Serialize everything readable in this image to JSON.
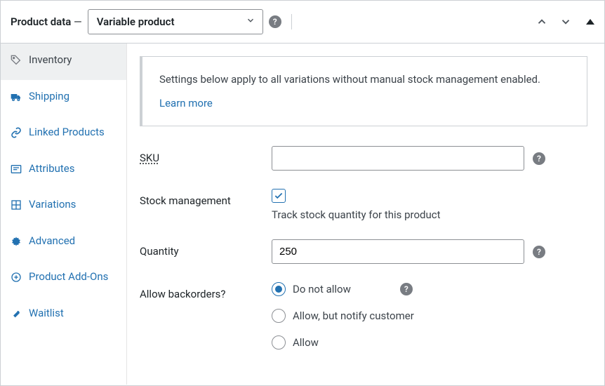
{
  "header": {
    "title_prefix": "Product data",
    "dash": " — ",
    "product_type": "Variable product"
  },
  "sidebar": {
    "items": [
      {
        "label": "Inventory"
      },
      {
        "label": "Shipping"
      },
      {
        "label": "Linked Products"
      },
      {
        "label": "Attributes"
      },
      {
        "label": "Variations"
      },
      {
        "label": "Advanced"
      },
      {
        "label": "Product Add-Ons"
      },
      {
        "label": "Waitlist"
      }
    ]
  },
  "notice": {
    "text": "Settings below apply to all variations without manual stock management enabled.",
    "link": "Learn more"
  },
  "form": {
    "sku": {
      "label": "SKU",
      "value": ""
    },
    "stock_management": {
      "label": "Stock management",
      "checked": true,
      "description": "Track stock quantity for this product"
    },
    "quantity": {
      "label": "Quantity",
      "value": "250"
    },
    "backorders": {
      "label": "Allow backorders?",
      "selected": 0,
      "options": [
        "Do not allow",
        "Allow, but notify customer",
        "Allow"
      ]
    }
  },
  "glyphs": {
    "help": "?"
  }
}
